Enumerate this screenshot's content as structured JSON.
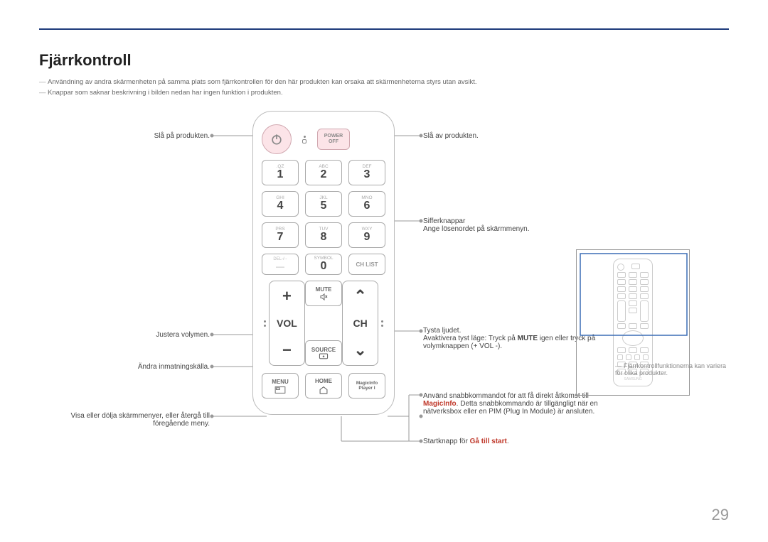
{
  "page": {
    "title": "Fjärrkontroll",
    "number": "29"
  },
  "notes": [
    "Användning av andra skärmenheten på samma plats som fjärrkontrollen för den här produkten kan orsaka att skärmenheterna styrs utan avsikt.",
    "Knappar som saknar beskrivning i bilden nedan har ingen funktion i produkten."
  ],
  "labels_left": {
    "power_on": "Slå på produkten.",
    "volume": "Justera volymen.",
    "source": "Ändra inmatningskälla.",
    "menu": "Visa eller dölja skärmmenyer, eller återgå till föregående meny."
  },
  "labels_right": {
    "power_off": "Slå av produkten.",
    "numbers_title": "Sifferknappar",
    "numbers_sub": "Ange lösenordet på skärmmenyn.",
    "mute_title": "Tysta ljudet.",
    "mute_sub1": "Avaktivera tyst läge: Tryck på ",
    "mute_bold": "MUTE",
    "mute_sub2": " igen eller tryck på volymknappen (+ VOL -).",
    "magic_1": "Använd snabbkommandot för att få direkt åtkomst till ",
    "magic_red": "MagicInfo",
    "magic_2": ". Detta snabbkommando är tillgängligt när en nätverksbox eller en PIM (Plug In Module) är ansluten.",
    "home_1": "Startknapp för ",
    "home_red": "Gå till start",
    "home_2": "."
  },
  "footnote": "Fjärrkontrollfunktionerna kan variera för olika produkter.",
  "remote": {
    "power_off": "POWER\nOFF",
    "keypad": [
      {
        "sub": ".QZ",
        "num": "1"
      },
      {
        "sub": "ABC",
        "num": "2"
      },
      {
        "sub": "DEF",
        "num": "3"
      },
      {
        "sub": "GHI",
        "num": "4"
      },
      {
        "sub": "JKL",
        "num": "5"
      },
      {
        "sub": "MNO",
        "num": "6"
      },
      {
        "sub": "PRS",
        "num": "7"
      },
      {
        "sub": "TUV",
        "num": "8"
      },
      {
        "sub": "WXY",
        "num": "9"
      }
    ],
    "del": "DEL-/--",
    "symbol": "SYMBOL",
    "zero": "0",
    "chlist": "CH LIST",
    "vol": "VOL",
    "ch": "CH",
    "mute": "MUTE",
    "source": "SOURCE",
    "menu": "MENU",
    "home": "HOME",
    "magic": "MagicInfo\nPlayer I"
  }
}
